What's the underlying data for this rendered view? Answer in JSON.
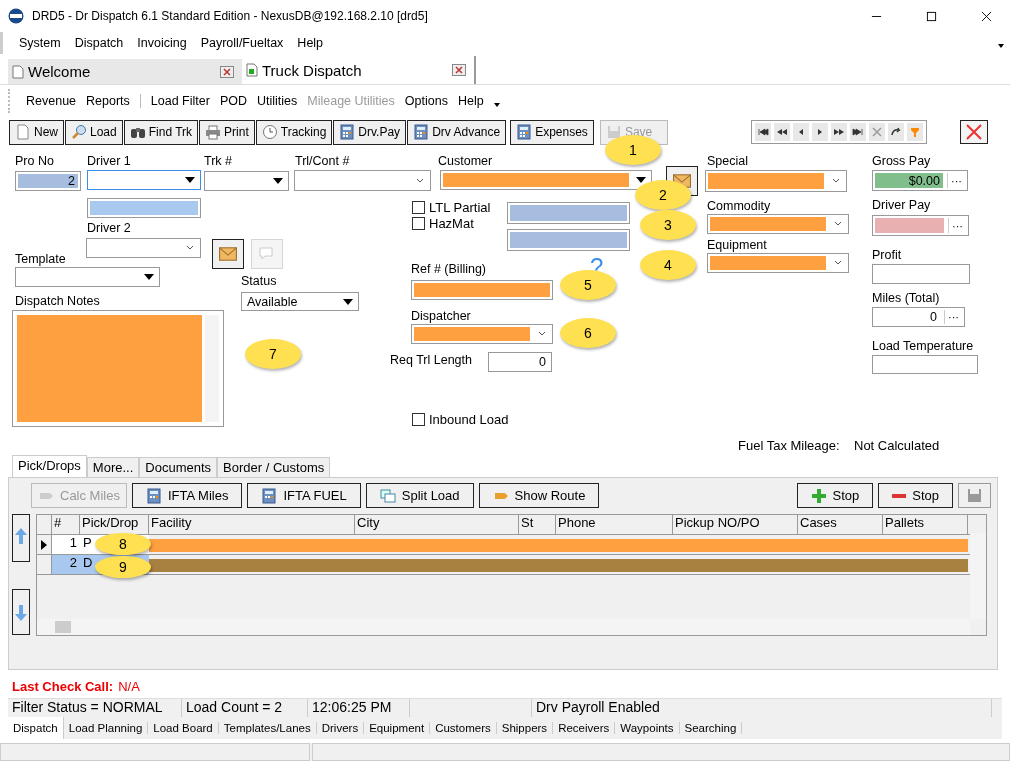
{
  "window": {
    "title": "DRD5 - Dr Dispatch 6.1 Standard Edition - NexusDB@192.168.2.10 [drd5]"
  },
  "menu": [
    "System",
    "Dispatch",
    "Invoicing",
    "Payroll/Fueltax",
    "Help"
  ],
  "doc_tabs": [
    {
      "label": "Welcome",
      "selected": false
    },
    {
      "label": "Truck Dispatch",
      "selected": true
    }
  ],
  "submenu": [
    {
      "label": "Revenue",
      "disabled": false
    },
    {
      "label": "Reports",
      "disabled": false
    },
    {
      "label": "Load Filter",
      "disabled": false
    },
    {
      "label": "POD",
      "disabled": false
    },
    {
      "label": "Utilities",
      "disabled": false
    },
    {
      "label": "Mileage Utilities",
      "disabled": true
    },
    {
      "label": "Options",
      "disabled": false
    },
    {
      "label": "Help",
      "disabled": false
    }
  ],
  "toolbar": [
    {
      "label": "New",
      "kind": "page",
      "disabled": false
    },
    {
      "label": "Load",
      "kind": "magnifier",
      "disabled": false
    },
    {
      "label": "Find Trk",
      "kind": "binoculars",
      "disabled": false
    },
    {
      "label": "Print",
      "kind": "printer",
      "disabled": false
    },
    {
      "label": "Tracking",
      "kind": "clock",
      "disabled": false
    },
    {
      "label": "Drv.Pay",
      "kind": "calculator",
      "disabled": false
    },
    {
      "label": "Drv Advance",
      "kind": "calculator",
      "disabled": false
    },
    {
      "label": "Expenses",
      "kind": "calculator",
      "disabled": false
    },
    {
      "label": "Save",
      "kind": "disk",
      "disabled": true
    }
  ],
  "fields": [
    {
      "kind": "text",
      "label": "Pro No",
      "value": "2",
      "color": "#a6bde0"
    },
    {
      "kind": "combo",
      "label": "Driver 1"
    },
    {
      "kind": "text",
      "color": "#a8c8f0"
    },
    {
      "kind": "combo",
      "label": "Driver 2"
    },
    {
      "kind": "combo",
      "label": "Trk #"
    },
    {
      "kind": "combo",
      "label": "Trl/Cont #"
    },
    {
      "kind": "combo",
      "label": "Customer",
      "color": "#ffa040"
    },
    {
      "kind": "checkbox",
      "label": "LTL Partial",
      "checked": false
    },
    {
      "kind": "checkbox",
      "label": "HazMat",
      "checked": false
    },
    {
      "kind": "text",
      "color": "#a6bde0"
    },
    {
      "kind": "text",
      "color": "#a6bde0"
    },
    {
      "kind": "combo",
      "label": "Template"
    },
    {
      "kind": "memo",
      "label": "Dispatch Notes",
      "color": "#ffa040"
    },
    {
      "kind": "combo",
      "label": "Status",
      "value": "Available"
    },
    {
      "kind": "text",
      "label": "Ref # (Billing)",
      "color": "#ffa040"
    },
    {
      "kind": "combo",
      "label": "Dispatcher",
      "color": "#ffa040"
    },
    {
      "kind": "text",
      "label": "Req Trl Length",
      "value": "0"
    },
    {
      "kind": "checkbox",
      "label": "Inbound Load",
      "checked": false
    },
    {
      "kind": "combo",
      "label": "Special",
      "color": "#ffa040"
    },
    {
      "kind": "combo",
      "label": "Commodity",
      "color": "#ffa040"
    },
    {
      "kind": "combo",
      "label": "Equipment",
      "color": "#ffa040"
    },
    {
      "kind": "text",
      "label": "Gross Pay",
      "value": "$0.00",
      "color": "#80bf8c",
      "button": "···"
    },
    {
      "kind": "text",
      "label": "Driver Pay",
      "color": "#e8b0b0",
      "button": "···"
    },
    {
      "kind": "text",
      "label": "Profit"
    },
    {
      "kind": "text",
      "label": "Miles (Total)",
      "value": "0",
      "button": "···"
    },
    {
      "kind": "text",
      "label": "Load Temperature"
    }
  ],
  "icon_buttons": [
    {
      "disabled": false
    },
    {
      "disabled": false
    },
    {
      "disabled": true
    }
  ],
  "help_mark": "?",
  "fuel_tax": {
    "label": "Fuel Tax Mileage:",
    "value": "Not Calculated"
  },
  "callouts": [
    "1",
    "2",
    "3",
    "4",
    "5",
    "6",
    "7",
    "8",
    "9"
  ],
  "stop_tabs": [
    {
      "label": "Pick/Drops",
      "selected": true
    },
    {
      "label": "More...",
      "selected": false
    },
    {
      "label": "Documents",
      "selected": false
    },
    {
      "label": "Border / Customs",
      "selected": false
    }
  ],
  "stop_buttons": [
    {
      "label": "Calc Miles",
      "kind": "route",
      "disabled": true
    },
    {
      "label": "IFTA Miles",
      "kind": "calculator",
      "disabled": false
    },
    {
      "label": "IFTA FUEL",
      "kind": "calculator",
      "disabled": false
    },
    {
      "label": "Split Load",
      "kind": "windows",
      "disabled": false
    },
    {
      "label": "Show Route",
      "kind": "route",
      "disabled": false
    },
    {
      "label": "Stop",
      "kind": "plus",
      "disabled": false
    },
    {
      "label": "Stop",
      "kind": "minus",
      "disabled": false
    }
  ],
  "grid": {
    "columns": [
      "#",
      "Pick/Drop",
      "Facility",
      "City",
      "St",
      "Phone",
      "Pickup NO/PO",
      "Cases",
      "Pallets"
    ],
    "rows": [
      {
        "num": "1",
        "code": "P",
        "color": "#ffa040",
        "selected": false
      },
      {
        "num": "2",
        "code": "D",
        "color": "#a88040",
        "selected": true
      }
    ]
  },
  "last_check_call": {
    "label": "Last Check Call:",
    "value": "N/A"
  },
  "status_bar": [
    "Filter Status = NORMAL",
    "Load Count = 2",
    "12:06:25 PM",
    "Drv Payroll Enabled"
  ],
  "bottom_tabs": [
    {
      "label": "Dispatch",
      "selected": true
    },
    {
      "label": "Load Planning",
      "selected": false
    },
    {
      "label": "Load Board",
      "selected": false
    },
    {
      "label": "Templates/Lanes",
      "selected": false
    },
    {
      "label": "Drivers",
      "selected": false
    },
    {
      "label": "Equipment",
      "selected": false
    },
    {
      "label": "Customers",
      "selected": false
    },
    {
      "label": "Shippers",
      "selected": false
    },
    {
      "label": "Receivers",
      "selected": false
    },
    {
      "label": "Waypoints",
      "selected": false
    },
    {
      "label": "Searching",
      "selected": false
    }
  ]
}
